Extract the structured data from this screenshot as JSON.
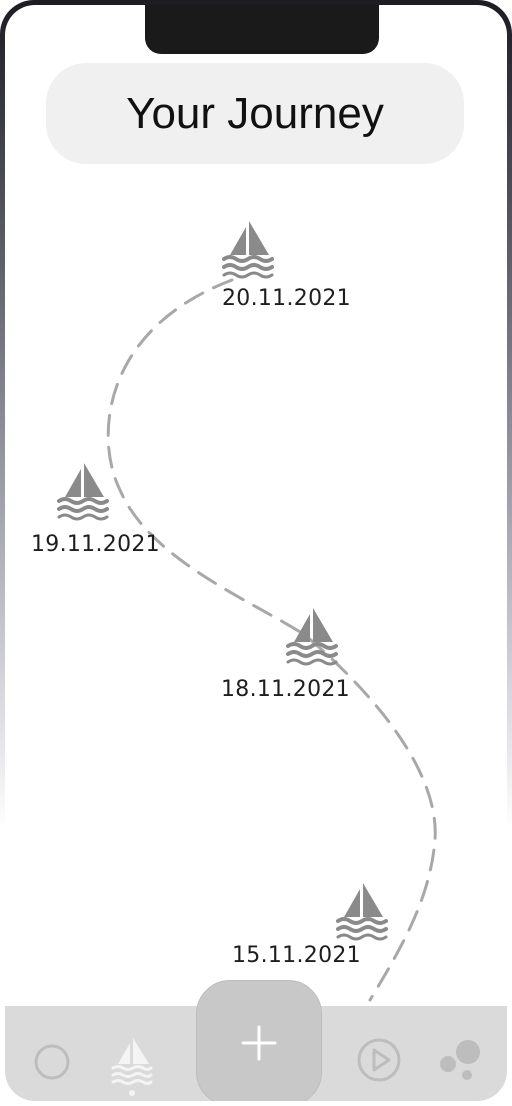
{
  "header": {
    "title": "Your Journey"
  },
  "journey": {
    "entries": [
      {
        "date": "20.11.2021",
        "icon": "sailboat-icon"
      },
      {
        "date": "19.11.2021",
        "icon": "sailboat-icon"
      },
      {
        "date": "18.11.2021",
        "icon": "sailboat-icon"
      },
      {
        "date": "15.11.2021",
        "icon": "sailboat-icon"
      }
    ]
  },
  "tabbar": {
    "items": [
      {
        "icon": "circle-icon",
        "active": false
      },
      {
        "icon": "sailboat-icon",
        "active": true
      },
      {
        "icon": "plus-icon",
        "primary": true
      },
      {
        "icon": "play-circle-icon",
        "active": false
      },
      {
        "icon": "bubbles-icon",
        "active": false
      }
    ]
  },
  "colors": {
    "boat": "#8a8a8a",
    "path": "#a8a8a8",
    "tabbar_bg": "#dadada",
    "tab_icon": "#bdbdbd",
    "active_tab_icon": "#f4f4f4"
  }
}
